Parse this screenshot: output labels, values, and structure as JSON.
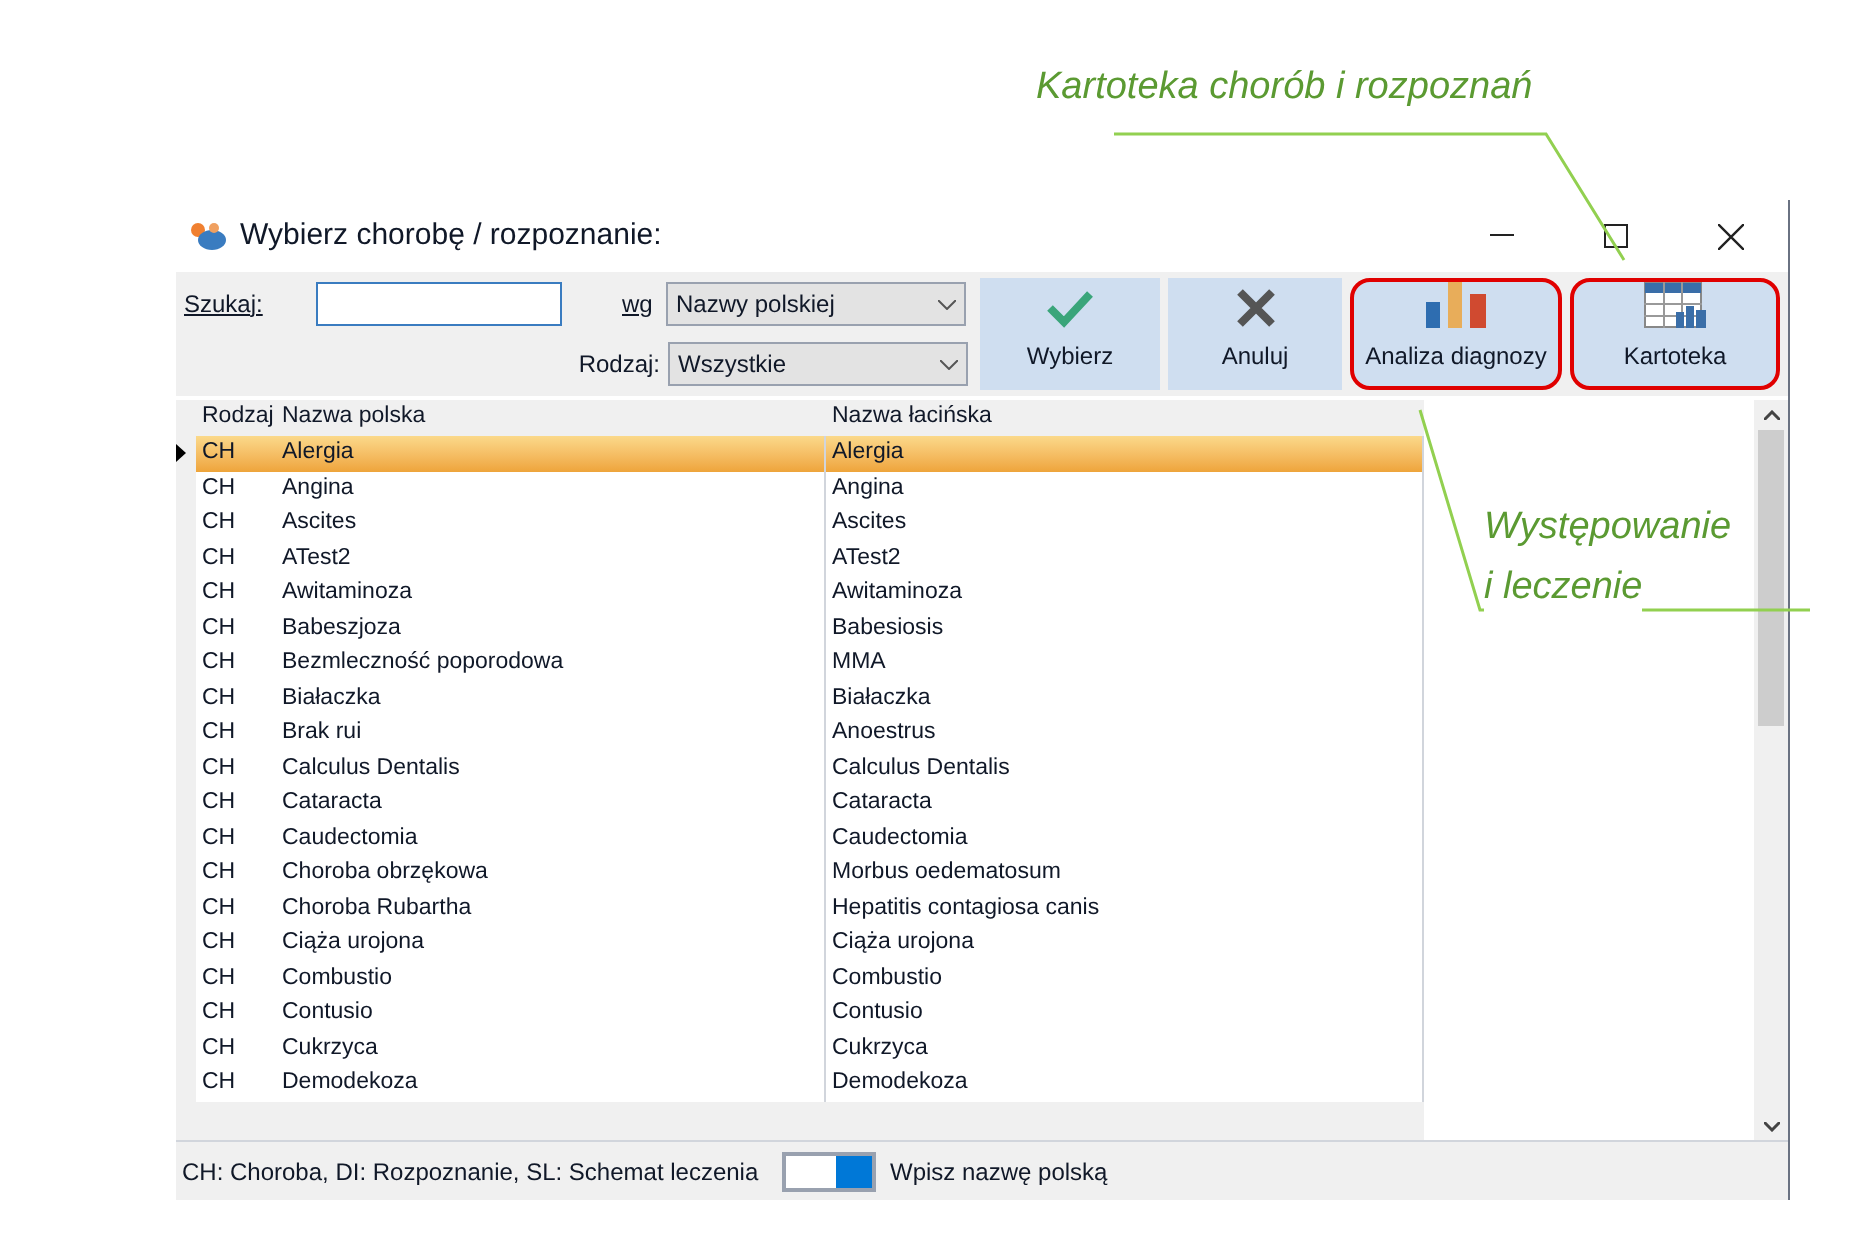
{
  "annotations": [
    {
      "text": "Kartoteka chorób i rozpoznań"
    },
    {
      "text": "Występowanie"
    },
    {
      "text": "i leczenie"
    }
  ],
  "window": {
    "title": "Wybierz chorobę / rozpoznanie:"
  },
  "search": {
    "label": "Szukaj:",
    "by_label": "wg",
    "by_value": "Nazwy polskiej",
    "kind_label": "Rodzaj:",
    "kind_value": "Wszystkie"
  },
  "buttons": [
    {
      "label": "Wybierz",
      "kind": "check",
      "highlighted": false
    },
    {
      "label": "Anuluj",
      "kind": "cancel",
      "highlighted": false
    },
    {
      "label": "Analiza diagnozy",
      "kind": "chart",
      "highlighted": true
    },
    {
      "label": "Kartoteka",
      "kind": "table",
      "highlighted": true
    }
  ],
  "table": {
    "columns": [
      "Rodzaj",
      "Nazwa polska",
      "Nazwa łacińska"
    ],
    "rows": [
      {
        "cells": [
          "CH",
          "Alergia",
          "Alergia"
        ],
        "selected": true
      },
      {
        "cells": [
          "CH",
          "Angina",
          "Angina"
        ],
        "selected": false
      },
      {
        "cells": [
          "CH",
          "Ascites",
          "Ascites"
        ],
        "selected": false
      },
      {
        "cells": [
          "CH",
          "ATest2",
          "ATest2"
        ],
        "selected": false
      },
      {
        "cells": [
          "CH",
          "Awitaminoza",
          "Awitaminoza"
        ],
        "selected": false
      },
      {
        "cells": [
          "CH",
          "Babeszjoza",
          "Babesiosis"
        ],
        "selected": false
      },
      {
        "cells": [
          "CH",
          "Bezmleczność poporodowa",
          "MMA"
        ],
        "selected": false
      },
      {
        "cells": [
          "CH",
          "Białaczka",
          "Białaczka"
        ],
        "selected": false
      },
      {
        "cells": [
          "CH",
          "Brak rui",
          "Anoestrus"
        ],
        "selected": false
      },
      {
        "cells": [
          "CH",
          "Calculus Dentalis",
          "Calculus Dentalis"
        ],
        "selected": false
      },
      {
        "cells": [
          "CH",
          "Cataracta",
          "Cataracta"
        ],
        "selected": false
      },
      {
        "cells": [
          "CH",
          "Caudectomia",
          "Caudectomia"
        ],
        "selected": false
      },
      {
        "cells": [
          "CH",
          "Choroba obrzękowa",
          "Morbus oedematosum"
        ],
        "selected": false
      },
      {
        "cells": [
          "CH",
          "Choroba Rubartha",
          "Hepatitis contagiosa canis"
        ],
        "selected": false
      },
      {
        "cells": [
          "CH",
          "Ciąża urojona",
          "Ciąża urojona"
        ],
        "selected": false
      },
      {
        "cells": [
          "CH",
          "Combustio",
          "Combustio"
        ],
        "selected": false
      },
      {
        "cells": [
          "CH",
          "Contusio",
          "Contusio"
        ],
        "selected": false
      },
      {
        "cells": [
          "CH",
          "Cukrzyca",
          "Cukrzyca"
        ],
        "selected": false
      },
      {
        "cells": [
          "CH",
          "Demodekoza",
          "Demodekoza"
        ],
        "selected": false
      }
    ]
  },
  "status_bar": {
    "legend": "CH: Choroba, DI: Rozpoznanie, SL: Schemat leczenia",
    "toggle": {
      "on": true
    },
    "hint": "Wpisz nazwę polską"
  }
}
